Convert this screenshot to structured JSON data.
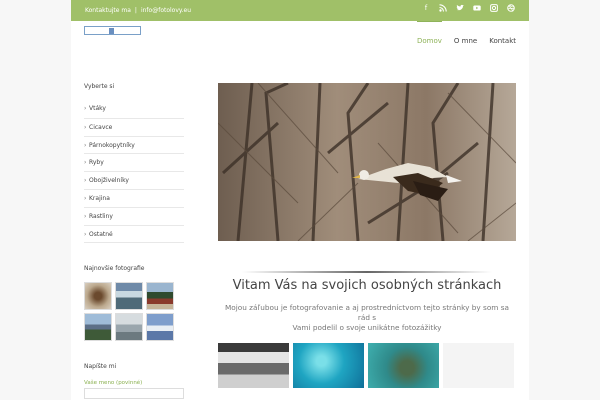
{
  "topbar": {
    "contact_label": "Kontaktujte ma",
    "email": "info@fotolovy.eu",
    "social_icons": [
      "facebook-icon",
      "rss-icon",
      "twitter-icon",
      "youtube-icon",
      "instagram-icon",
      "dribbble-icon"
    ]
  },
  "nav": {
    "items": [
      {
        "label": "Domov",
        "active": true
      },
      {
        "label": "O mne",
        "active": false
      },
      {
        "label": "Kontakt",
        "active": false
      }
    ]
  },
  "sidebar": {
    "categories_title": "Vyberte si",
    "categories": [
      "Vtáky",
      "Cicavce",
      "Párnokopytníky",
      "Ryby",
      "Obojživelníky",
      "Krajina",
      "Rastliny",
      "Ostatné"
    ],
    "photos_title": "Najnovšie fotografie",
    "form_title": "Napíšte mi",
    "name_label": "Vaše meno (povinné)"
  },
  "content": {
    "welcome": "Vitam Vás na svojich osobných stránkach",
    "intro_line1": "Mojou záľubou je fotografovanie a aj prostredníctvom tejto stránky by som sa rád s",
    "intro_line2": "Vami podelil o svoje unikátne fotozážitky"
  },
  "colors": {
    "accent": "#a0c068",
    "nav_active": "#8fb35a"
  }
}
